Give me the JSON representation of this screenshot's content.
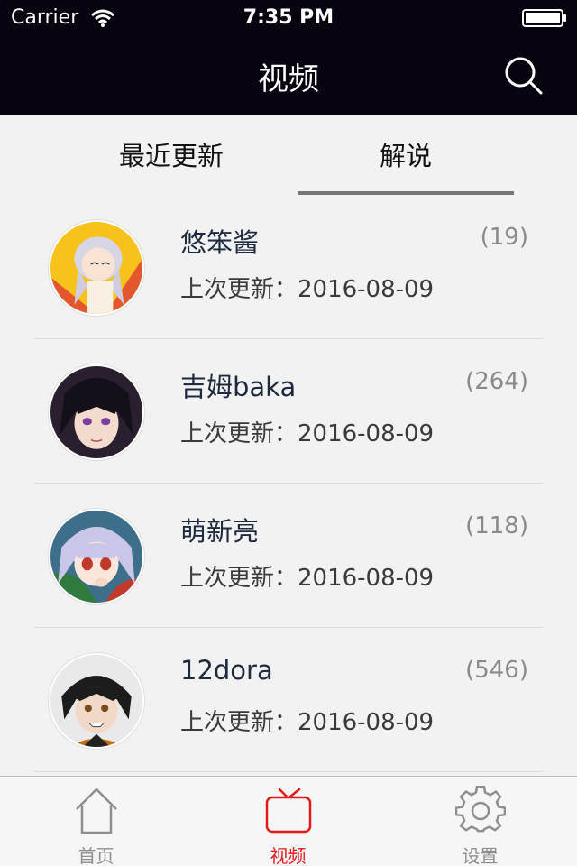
{
  "status_bar": {
    "carrier": "Carrier",
    "time": "7:35 PM"
  },
  "nav": {
    "title": "视频"
  },
  "segments": {
    "recent": "最近更新",
    "commentary": "解说",
    "selected": "解说"
  },
  "list": [
    {
      "name": "悠笨酱",
      "count": "(19)",
      "updated": "上次更新：2016-08-09"
    },
    {
      "name": "吉姆baka",
      "count": "(264)",
      "updated": "上次更新：2016-08-09"
    },
    {
      "name": "萌新亮",
      "count": "(118)",
      "updated": "上次更新：2016-08-09"
    },
    {
      "name": "12dora",
      "count": "(546)",
      "updated": "上次更新：2016-08-09"
    }
  ],
  "tabbar": {
    "items": [
      {
        "label": "首页",
        "icon": "home-icon"
      },
      {
        "label": "视频",
        "icon": "tv-icon"
      },
      {
        "label": "设置",
        "icon": "gear-icon"
      }
    ],
    "active_index": 1,
    "active_color": "#e11a1a"
  }
}
